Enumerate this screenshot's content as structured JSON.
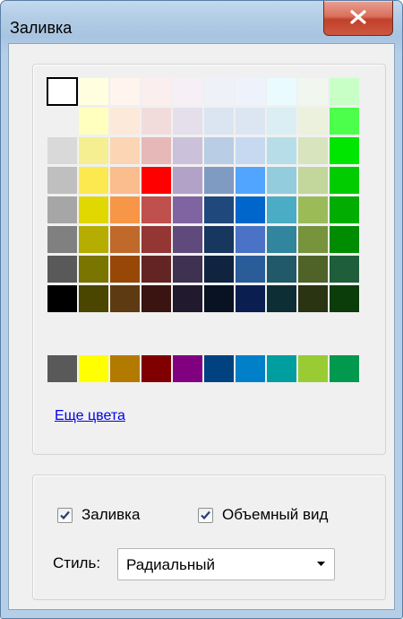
{
  "window": {
    "title": "Заливка"
  },
  "palette": {
    "rows": [
      [
        "#ffffff",
        "#ffffe0",
        "#fff4ee",
        "#fbeeee",
        "#f6f0f6",
        "#eef1f7",
        "#eef3fb",
        "#e9fbff",
        "#f1f7ee",
        "#c7ffc7"
      ],
      [
        "#f0f0f0",
        "#ffffbe",
        "#fde9d9",
        "#f2dcdb",
        "#e5dfec",
        "#dbe5f1",
        "#dce6f2",
        "#daeef3",
        "#ebf1dd",
        "#4bff4b"
      ],
      [
        "#d9d9d9",
        "#f5ef91",
        "#fcd5b5",
        "#e6b9b8",
        "#ccc1da",
        "#b9cde5",
        "#c6d9f1",
        "#b7dee8",
        "#d7e4bd",
        "#00e600"
      ],
      [
        "#bfbfbf",
        "#fce94f",
        "#fbbc8e",
        "#ff0000",
        "#b3a2c7",
        "#7f9bc1",
        "#51a5ff",
        "#93cddd",
        "#c3d69b",
        "#00cc00"
      ],
      [
        "#a6a6a6",
        "#e0d800",
        "#f79646",
        "#c0504d",
        "#8064a2",
        "#1f497d",
        "#0066cc",
        "#4bacc6",
        "#9bbb59",
        "#00ad00"
      ],
      [
        "#808080",
        "#b5ad00",
        "#c0692a",
        "#943634",
        "#604a7b",
        "#17375e",
        "#4a72c7",
        "#31859c",
        "#77933c",
        "#008c00"
      ],
      [
        "#595959",
        "#7a7400",
        "#974806",
        "#632523",
        "#3f3151",
        "#10243f",
        "#2a5c9a",
        "#215968",
        "#4f6228",
        "#1e5e3a"
      ],
      [
        "#000000",
        "#4a4600",
        "#5e3a12",
        "#3a1410",
        "#21192e",
        "#081222",
        "#0a1e50",
        "#0d2e34",
        "#2a3312",
        "#0b3d0b"
      ]
    ],
    "standard": [
      "#595959",
      "#ffff00",
      "#b37a00",
      "#800000",
      "#800080",
      "#00427f",
      "#0080c8",
      "#009e9e",
      "#99cc33",
      "#00994d"
    ],
    "selected": "#ffffff"
  },
  "more_colors_link": "Еще цвета",
  "fill_checkbox": {
    "label": "Заливка",
    "checked": true
  },
  "volume_checkbox": {
    "label": "Объемный вид",
    "checked": true
  },
  "style_field": {
    "label": "Стиль:",
    "value": "Радиальный"
  }
}
